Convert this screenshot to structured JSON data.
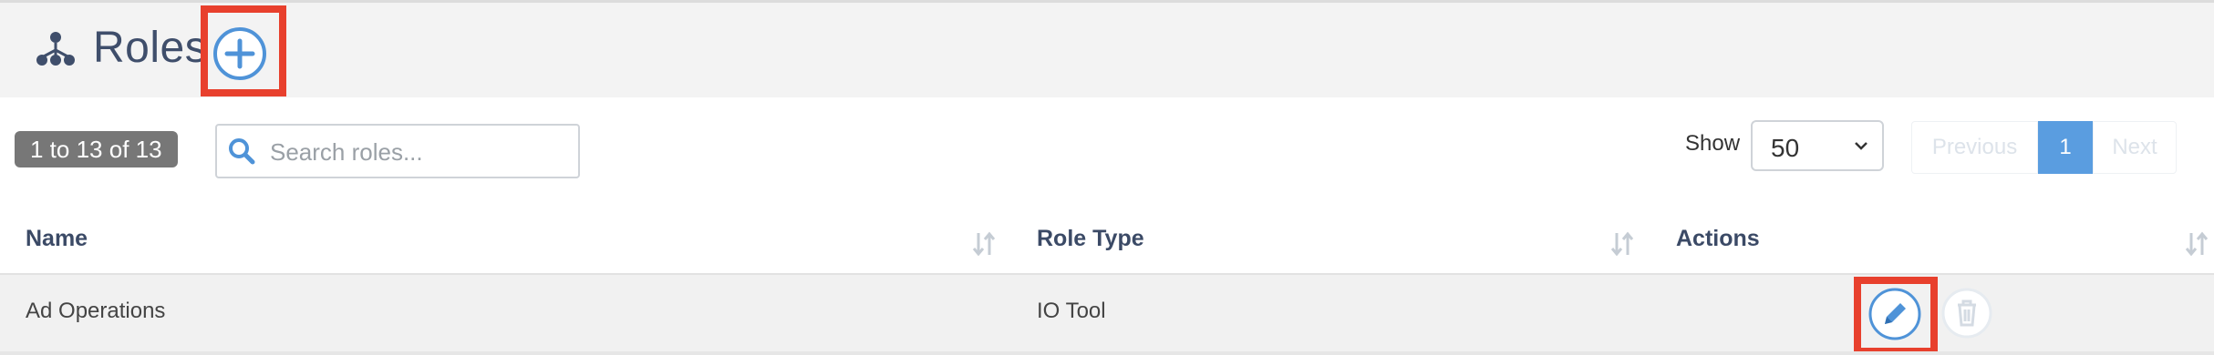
{
  "header": {
    "title": "Roles",
    "title_icon": "org-tree-icon",
    "add_icon": "plus-circle-icon"
  },
  "toolbar": {
    "count_text": "1 to 13 of 13",
    "search_placeholder": "Search roles...",
    "search_value": "",
    "show_label": "Show",
    "show_value": "50"
  },
  "pagination": {
    "previous_label": "Previous",
    "current_page": "1",
    "next_label": "Next"
  },
  "table": {
    "columns": [
      "Name",
      "Role Type",
      "Actions"
    ],
    "rows": [
      {
        "name": "Ad Operations",
        "role_type": "IO Tool"
      }
    ]
  },
  "colors": {
    "accent": "#5a9de0",
    "highlight": "#e8402d",
    "title": "#3f4e6b"
  }
}
